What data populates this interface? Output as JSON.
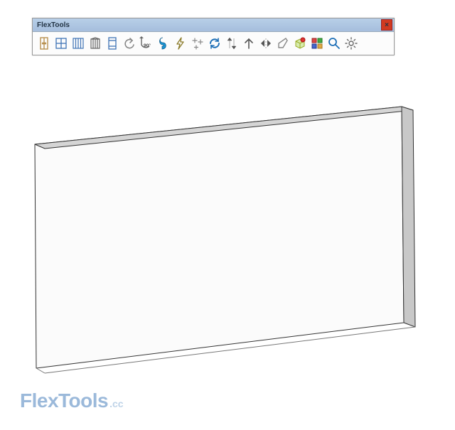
{
  "toolbar": {
    "title": "FlexTools",
    "close": "×",
    "buttons": [
      {
        "name": "door-tool",
        "title": "Door"
      },
      {
        "name": "window-tool",
        "title": "Window"
      },
      {
        "name": "divider-tool",
        "title": "Divider"
      },
      {
        "name": "wedge-tool",
        "title": "Wedge"
      },
      {
        "name": "panel-tool",
        "title": "Panel"
      },
      {
        "name": "undo-tool",
        "title": "Undo"
      },
      {
        "name": "rotate90-tool",
        "title": "Rotate 90°"
      },
      {
        "name": "super-tool",
        "title": "Super Tool"
      },
      {
        "name": "lightning-tool",
        "title": "Action"
      },
      {
        "name": "sparkle-tool",
        "title": "Sparkle"
      },
      {
        "name": "refresh-tool",
        "title": "Refresh"
      },
      {
        "name": "up-down-tool",
        "title": "Up/Down"
      },
      {
        "name": "arrow-up-tool",
        "title": "Up"
      },
      {
        "name": "mirror-tool",
        "title": "Mirror"
      },
      {
        "name": "edit-tool",
        "title": "Edit"
      },
      {
        "name": "cube-tool",
        "title": "Cube"
      },
      {
        "name": "palette-tool",
        "title": "Palette"
      },
      {
        "name": "zoom-tool",
        "title": "Zoom"
      },
      {
        "name": "settings-tool",
        "title": "Settings"
      }
    ]
  },
  "watermark": {
    "brand": "FlexTools",
    "suffix": ".cc"
  }
}
